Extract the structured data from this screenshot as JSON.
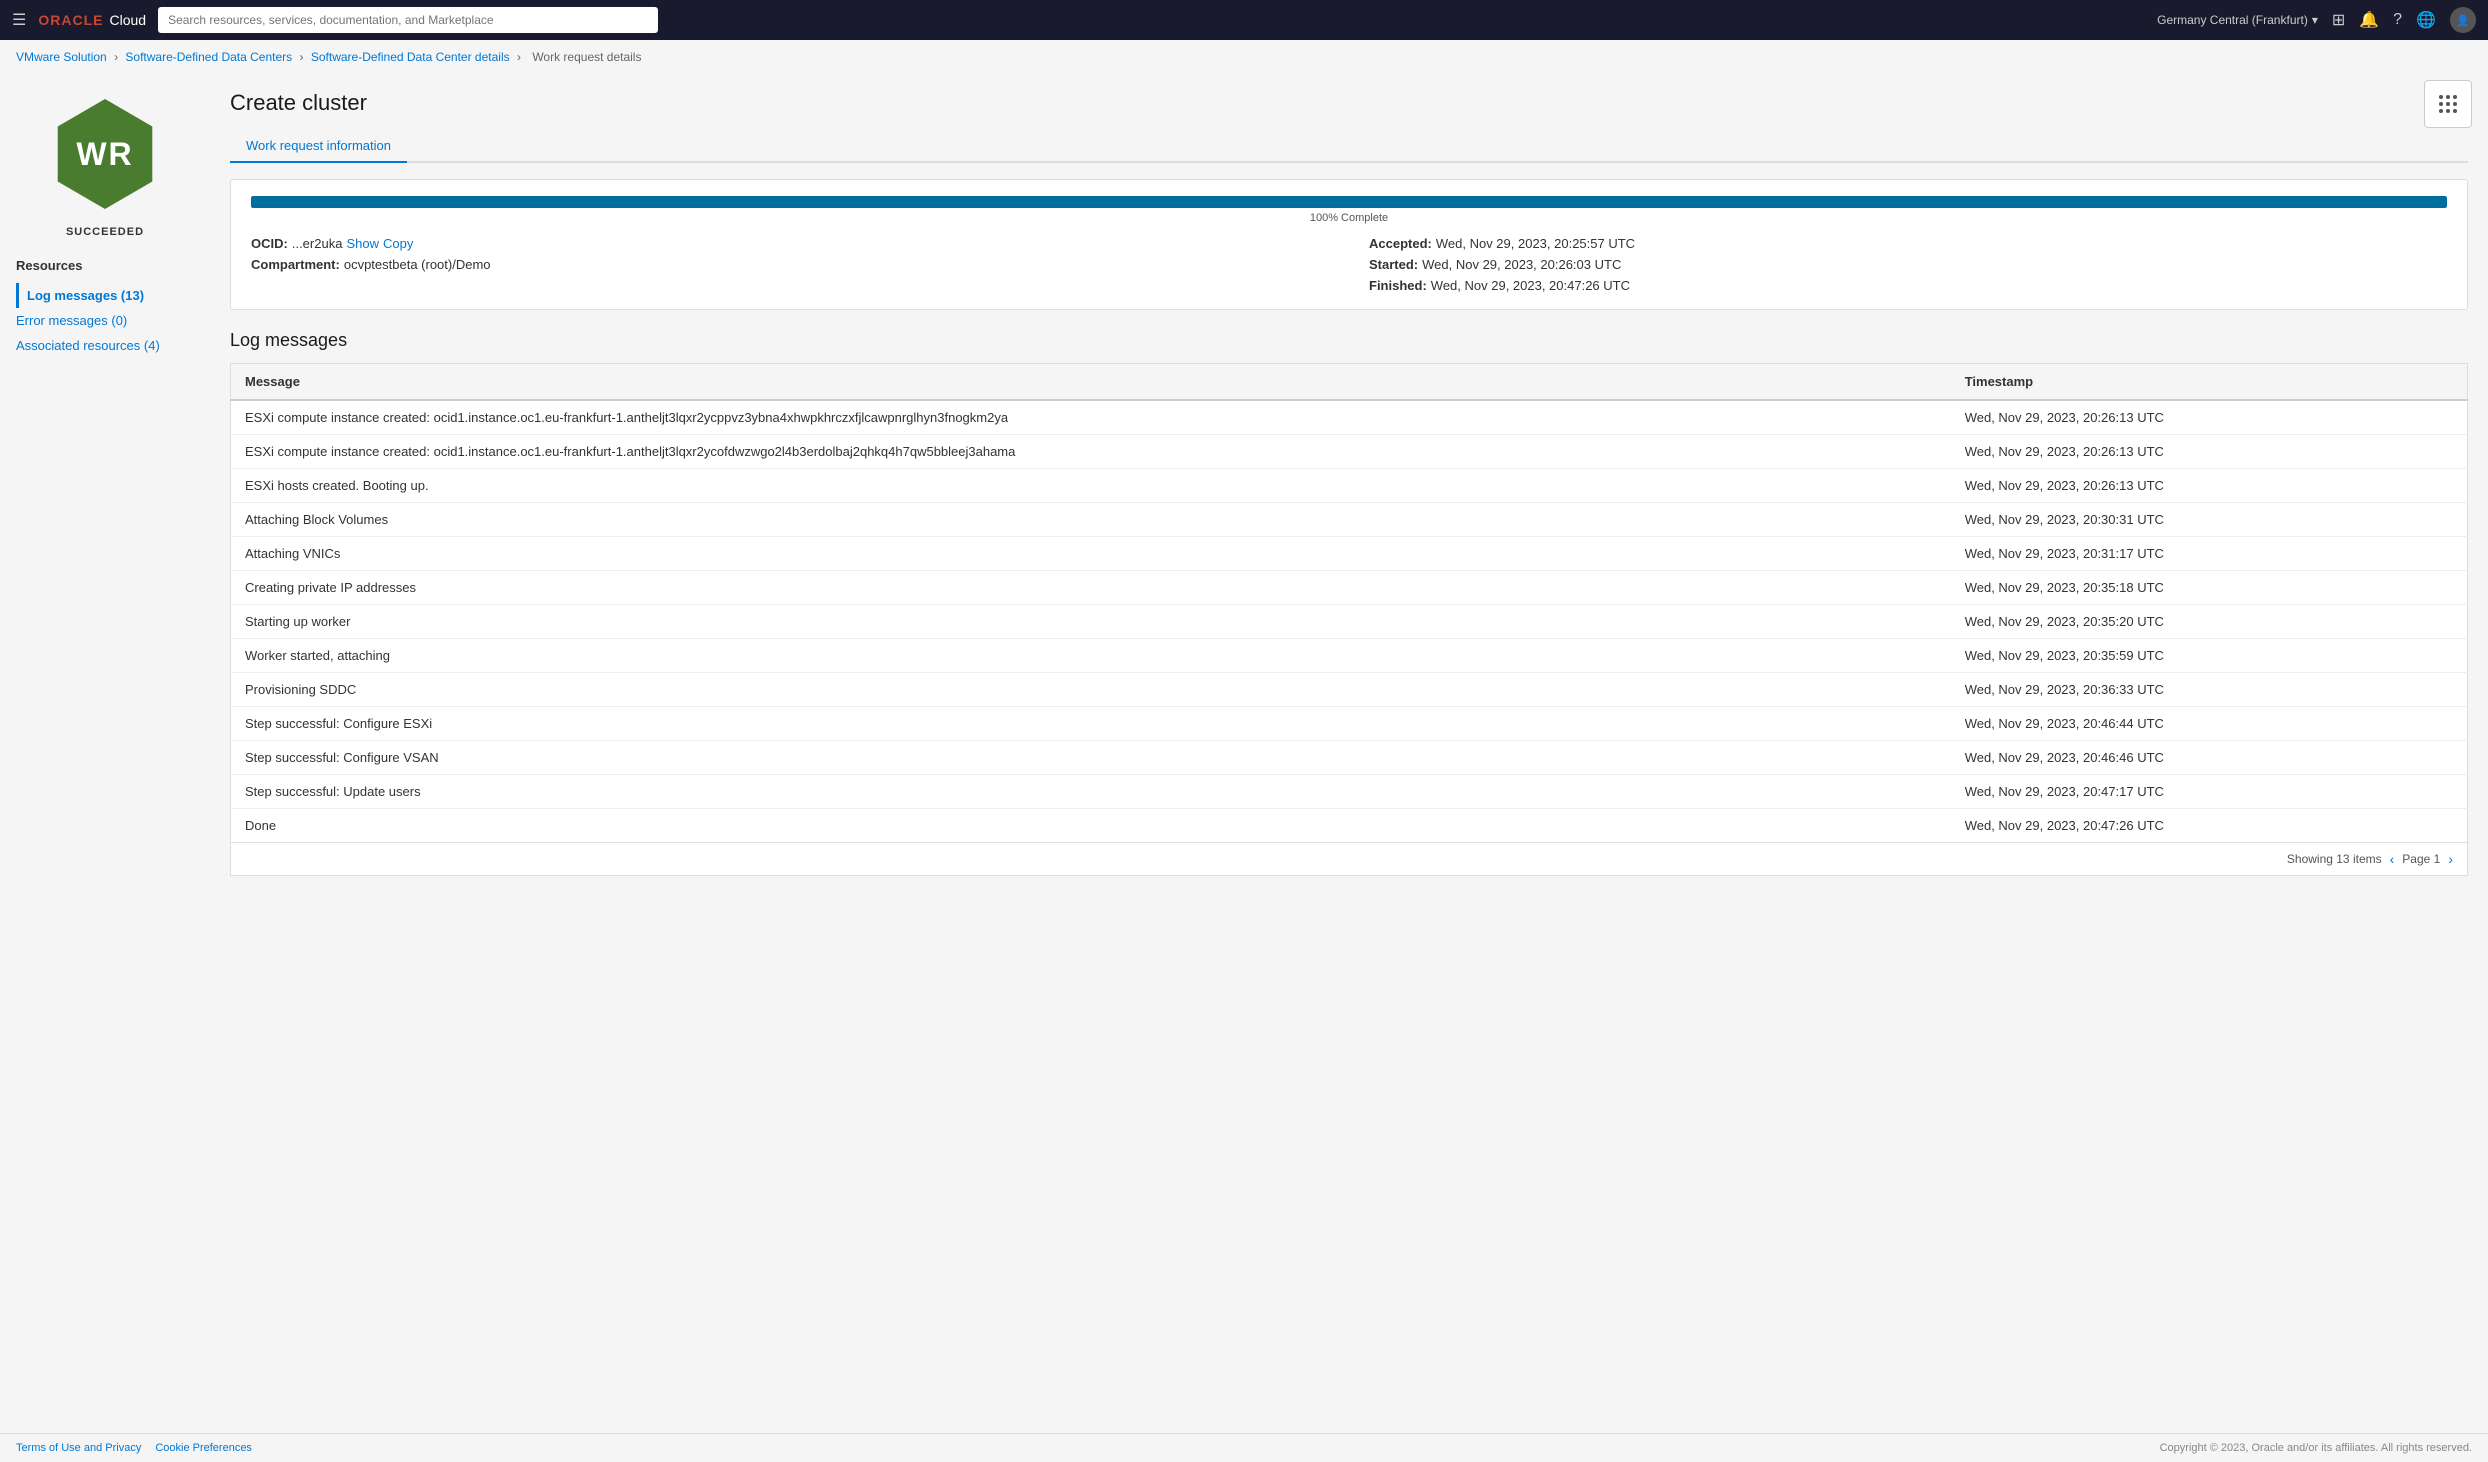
{
  "topnav": {
    "search_placeholder": "Search resources, services, documentation, and Marketplace",
    "region": "Germany Central (Frankfurt)",
    "oracle_text": "ORACLE",
    "cloud_text": "Cloud"
  },
  "breadcrumb": {
    "items": [
      {
        "label": "VMware Solution",
        "href": "#"
      },
      {
        "label": "Software-Defined Data Centers",
        "href": "#"
      },
      {
        "label": "Software-Defined Data Center details",
        "href": "#"
      },
      {
        "label": "Work request details",
        "href": null
      }
    ],
    "separators": [
      "›",
      "›",
      "›"
    ]
  },
  "page": {
    "title": "Create cluster",
    "tab_label": "Work request information",
    "status": "SUCCEEDED",
    "icon_text": "WR"
  },
  "work_request": {
    "progress_pct": 100,
    "progress_label": "100% Complete",
    "ocid_short": "...er2uka",
    "ocid_show": "Show",
    "ocid_copy": "Copy",
    "compartment_label": "Compartment:",
    "compartment_value": "ocvptestbeta (root)/Demo",
    "accepted_label": "Accepted:",
    "accepted_value": "Wed, Nov 29, 2023, 20:25:57 UTC",
    "started_label": "Started:",
    "started_value": "Wed, Nov 29, 2023, 20:26:03 UTC",
    "finished_label": "Finished:",
    "finished_value": "Wed, Nov 29, 2023, 20:47:26 UTC"
  },
  "resources_section": {
    "title": "Resources",
    "nav_items": [
      {
        "label": "Log messages (13)",
        "active": true,
        "href": "#"
      },
      {
        "label": "Error messages (0)",
        "active": false,
        "href": "#"
      },
      {
        "label": "Associated resources (4)",
        "active": false,
        "href": "#"
      }
    ]
  },
  "log_messages": {
    "section_title": "Log messages",
    "columns": [
      "Message",
      "Timestamp"
    ],
    "rows": [
      {
        "message": "ESXi compute instance created: ocid1.instance.oc1.eu-frankfurt-1.antheljt3lqxr2ycppvz3ybna4xhwpkhrczxfjlcawpnrglhyn3fnogkm2ya",
        "timestamp": "Wed, Nov 29, 2023, 20:26:13 UTC"
      },
      {
        "message": "ESXi compute instance created: ocid1.instance.oc1.eu-frankfurt-1.antheljt3lqxr2ycofdwzwgo2l4b3erdolbaj2qhkq4h7qw5bbleej3ahama",
        "timestamp": "Wed, Nov 29, 2023, 20:26:13 UTC"
      },
      {
        "message": "ESXi hosts created. Booting up.",
        "timestamp": "Wed, Nov 29, 2023, 20:26:13 UTC"
      },
      {
        "message": "Attaching Block Volumes",
        "timestamp": "Wed, Nov 29, 2023, 20:30:31 UTC"
      },
      {
        "message": "Attaching VNICs",
        "timestamp": "Wed, Nov 29, 2023, 20:31:17 UTC"
      },
      {
        "message": "Creating private IP addresses",
        "timestamp": "Wed, Nov 29, 2023, 20:35:18 UTC"
      },
      {
        "message": "Starting up worker",
        "timestamp": "Wed, Nov 29, 2023, 20:35:20 UTC"
      },
      {
        "message": "Worker started, attaching",
        "timestamp": "Wed, Nov 29, 2023, 20:35:59 UTC"
      },
      {
        "message": "Provisioning SDDC",
        "timestamp": "Wed, Nov 29, 2023, 20:36:33 UTC"
      },
      {
        "message": "Step successful: Configure ESXi",
        "timestamp": "Wed, Nov 29, 2023, 20:46:44 UTC"
      },
      {
        "message": "Step successful: Configure VSAN",
        "timestamp": "Wed, Nov 29, 2023, 20:46:46 UTC"
      },
      {
        "message": "Step successful: Update users",
        "timestamp": "Wed, Nov 29, 2023, 20:47:17 UTC"
      },
      {
        "message": "Done",
        "timestamp": "Wed, Nov 29, 2023, 20:47:26 UTC"
      }
    ],
    "showing_label": "Showing 13 items",
    "page_label": "Page 1"
  },
  "footer": {
    "terms_link": "Terms of Use and Privacy",
    "cookie_link": "Cookie Preferences",
    "copyright": "Copyright © 2023, Oracle and/or its affiliates. All rights reserved."
  }
}
